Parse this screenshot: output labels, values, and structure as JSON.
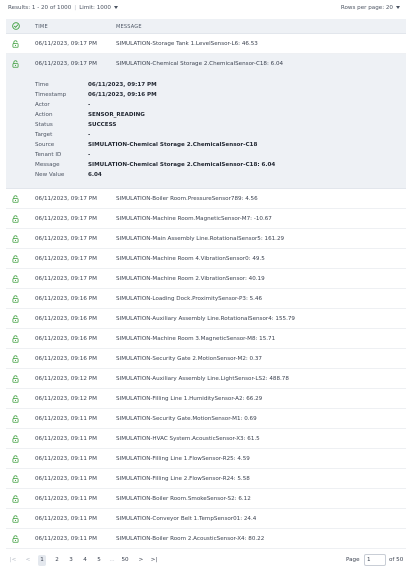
{
  "topbar": {
    "results_text": "Results: 1 - 20 of 1000",
    "limit_text": "Limit: 1000",
    "rows_per_page_label": "Rows per page:",
    "rows_per_page_value": "20"
  },
  "table": {
    "headers": {
      "time": "TIME",
      "message": "MESSAGE"
    },
    "first_row": {
      "time": "06/11/2023, 09:17 PM",
      "message": "SIMULATION-Storage Tank 1.LevelSensor-L6: 46.53"
    },
    "expanded_row": {
      "time": "06/11/2023, 09:17 PM",
      "message": "SIMULATION-Chemical Storage 2.ChemicalSensor-C18: 6.04"
    },
    "details": [
      {
        "label": "Time",
        "value": "06/11/2023, 09:17 PM"
      },
      {
        "label": "Timestamp",
        "value": "06/11/2023, 09:16 PM"
      },
      {
        "label": "Actor",
        "value": "-"
      },
      {
        "label": "Action",
        "value": "SENSOR_READING"
      },
      {
        "label": "Status",
        "value": "SUCCESS"
      },
      {
        "label": "Target",
        "value": "-"
      },
      {
        "label": "Source",
        "value": "SIMULATION-Chemical Storage 2.ChemicalSensor-C18"
      },
      {
        "label": "Tenant ID",
        "value": "-"
      },
      {
        "label": "Message",
        "value": "SIMULATION-Chemical Storage 2.ChemicalSensor-C18: 6.04"
      },
      {
        "label": "New Value",
        "value": "6.04"
      }
    ],
    "rows": [
      {
        "time": "06/11/2023, 09:17 PM",
        "message": "SIMULATION-Boiler Room.PressureSensor789: 4.56"
      },
      {
        "time": "06/11/2023, 09:17 PM",
        "message": "SIMULATION-Machine Room.MagneticSensor-M7: -10.67"
      },
      {
        "time": "06/11/2023, 09:17 PM",
        "message": "SIMULATION-Main Assembly Line.RotationalSensor5: 161.29"
      },
      {
        "time": "06/11/2023, 09:17 PM",
        "message": "SIMULATION-Machine Room 4.VibrationSensor0: 49.5"
      },
      {
        "time": "06/11/2023, 09:17 PM",
        "message": "SIMULATION-Machine Room 2.VibrationSensor: 40.19"
      },
      {
        "time": "06/11/2023, 09:16 PM",
        "message": "SIMULATION-Loading Dock.ProximitySensor-P3: 5.46"
      },
      {
        "time": "06/11/2023, 09:16 PM",
        "message": "SIMULATION-Auxiliary Assembly Line.RotationalSensor4: 155.79"
      },
      {
        "time": "06/11/2023, 09:16 PM",
        "message": "SIMULATION-Machine Room 3.MagneticSensor-M8: 15.71"
      },
      {
        "time": "06/11/2023, 09:16 PM",
        "message": "SIMULATION-Security Gate 2.MotionSensor-M2: 0.37"
      },
      {
        "time": "06/11/2023, 09:12 PM",
        "message": "SIMULATION-Auxiliary Assembly Line.LightSensor-LS2: 488.78"
      },
      {
        "time": "06/11/2023, 09:12 PM",
        "message": "SIMULATION-Filling Line 1.HumiditySensor-A2: 66.29"
      },
      {
        "time": "06/11/2023, 09:11 PM",
        "message": "SIMULATION-Security Gate.MotionSensor-M1: 0.69"
      },
      {
        "time": "06/11/2023, 09:11 PM",
        "message": "SIMULATION-HVAC System.AcousticSensor-X3: 61.5"
      },
      {
        "time": "06/11/2023, 09:11 PM",
        "message": "SIMULATION-Filling Line 1.FlowSensor-R25: 4.59"
      },
      {
        "time": "06/11/2023, 09:11 PM",
        "message": "SIMULATION-Filling Line 2.FlowSensor-R24: 5.58"
      },
      {
        "time": "06/11/2023, 09:11 PM",
        "message": "SIMULATION-Boiler Room.SmokeSensor-S2: 6.12"
      },
      {
        "time": "06/11/2023, 09:11 PM",
        "message": "SIMULATION-Conveyor Belt 1.TempSensor01: 24.4"
      },
      {
        "time": "06/11/2023, 09:11 PM",
        "message": "SIMULATION-Boiler Room 2.AcousticSensor-X4: 80.22"
      }
    ]
  },
  "pagination": {
    "first": "|<",
    "prev": "<",
    "pages": [
      "1",
      "2",
      "3",
      "4",
      "5"
    ],
    "ellipsis": "...",
    "last_page": "50",
    "next": ">",
    "last": ">|",
    "page_label": "Page",
    "current_page": "1",
    "of_text": "of 50"
  },
  "colors": {
    "success_icon": "#3a9d3a",
    "header_bg": "#eef1f5",
    "text": "#3b4250"
  },
  "icons": {
    "status": "lock-open-icon",
    "header": "check-circle-icon"
  }
}
